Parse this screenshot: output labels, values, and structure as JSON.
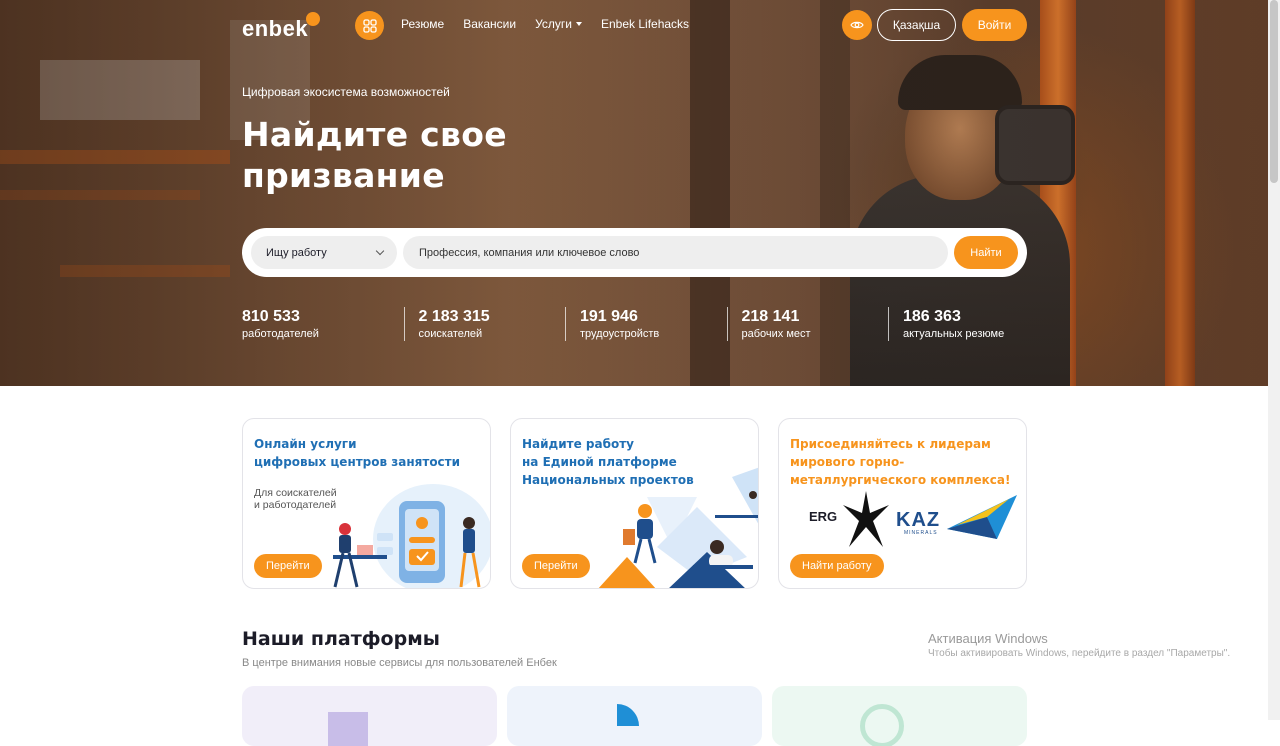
{
  "header": {
    "logo": "enbek",
    "nav": [
      {
        "label": "Резюме"
      },
      {
        "label": "Вакансии"
      },
      {
        "label": "Услуги",
        "has_dropdown": true
      },
      {
        "label": "Enbek Lifehacks"
      }
    ],
    "language_button": "Қазақша",
    "login_button": "Войти",
    "icons": [
      "apps-grid-icon",
      "eye-accessibility-icon"
    ]
  },
  "hero": {
    "tagline": "Цифровая экосистема возможностей",
    "headline": "Найдите свое призвание"
  },
  "search": {
    "type_selected": "Ищу работу",
    "placeholder": "Профессия, компания или ключевое слово",
    "button": "Найти"
  },
  "stats": [
    {
      "value": "810 533",
      "label": "работодателей"
    },
    {
      "value": "2 183 315",
      "label": "соискателей"
    },
    {
      "value": "191 946",
      "label": "трудоустройств"
    },
    {
      "value": "218 141",
      "label": "рабочих мест"
    },
    {
      "value": "186 363",
      "label": "актуальных резюме"
    }
  ],
  "promo_cards": [
    {
      "title": "Онлайн услуги\nцифровых центров занятости",
      "subtitle": "Для соискателей\nи работодателей",
      "button": "Перейти",
      "title_color": "#1f6fb4"
    },
    {
      "title": "Найдите работу\nна Единой платформе\nНациональных проектов",
      "button": "Перейти",
      "title_color": "#1f6fb4"
    },
    {
      "title": "Присоединяйтесь к лидерам\nмирового горно-\nметаллургического комплекса!",
      "button": "Найти работу",
      "title_color": "#f7941d",
      "logo_erg": "ERG",
      "logo_kaz": "KAZ",
      "logo_kaz_sub": "MINERALS"
    }
  ],
  "platforms": {
    "title": "Наши платформы",
    "subtitle": "В центре внимания новые сервисы для пользователей Енбек"
  },
  "watermark": {
    "title": "Активация Windows",
    "subtitle": "Чтобы активировать Windows, перейдите в раздел \"Параметры\"."
  },
  "colors": {
    "accent": "#f7941d",
    "blue": "#1f6fb4",
    "text": "#1c1c28"
  }
}
